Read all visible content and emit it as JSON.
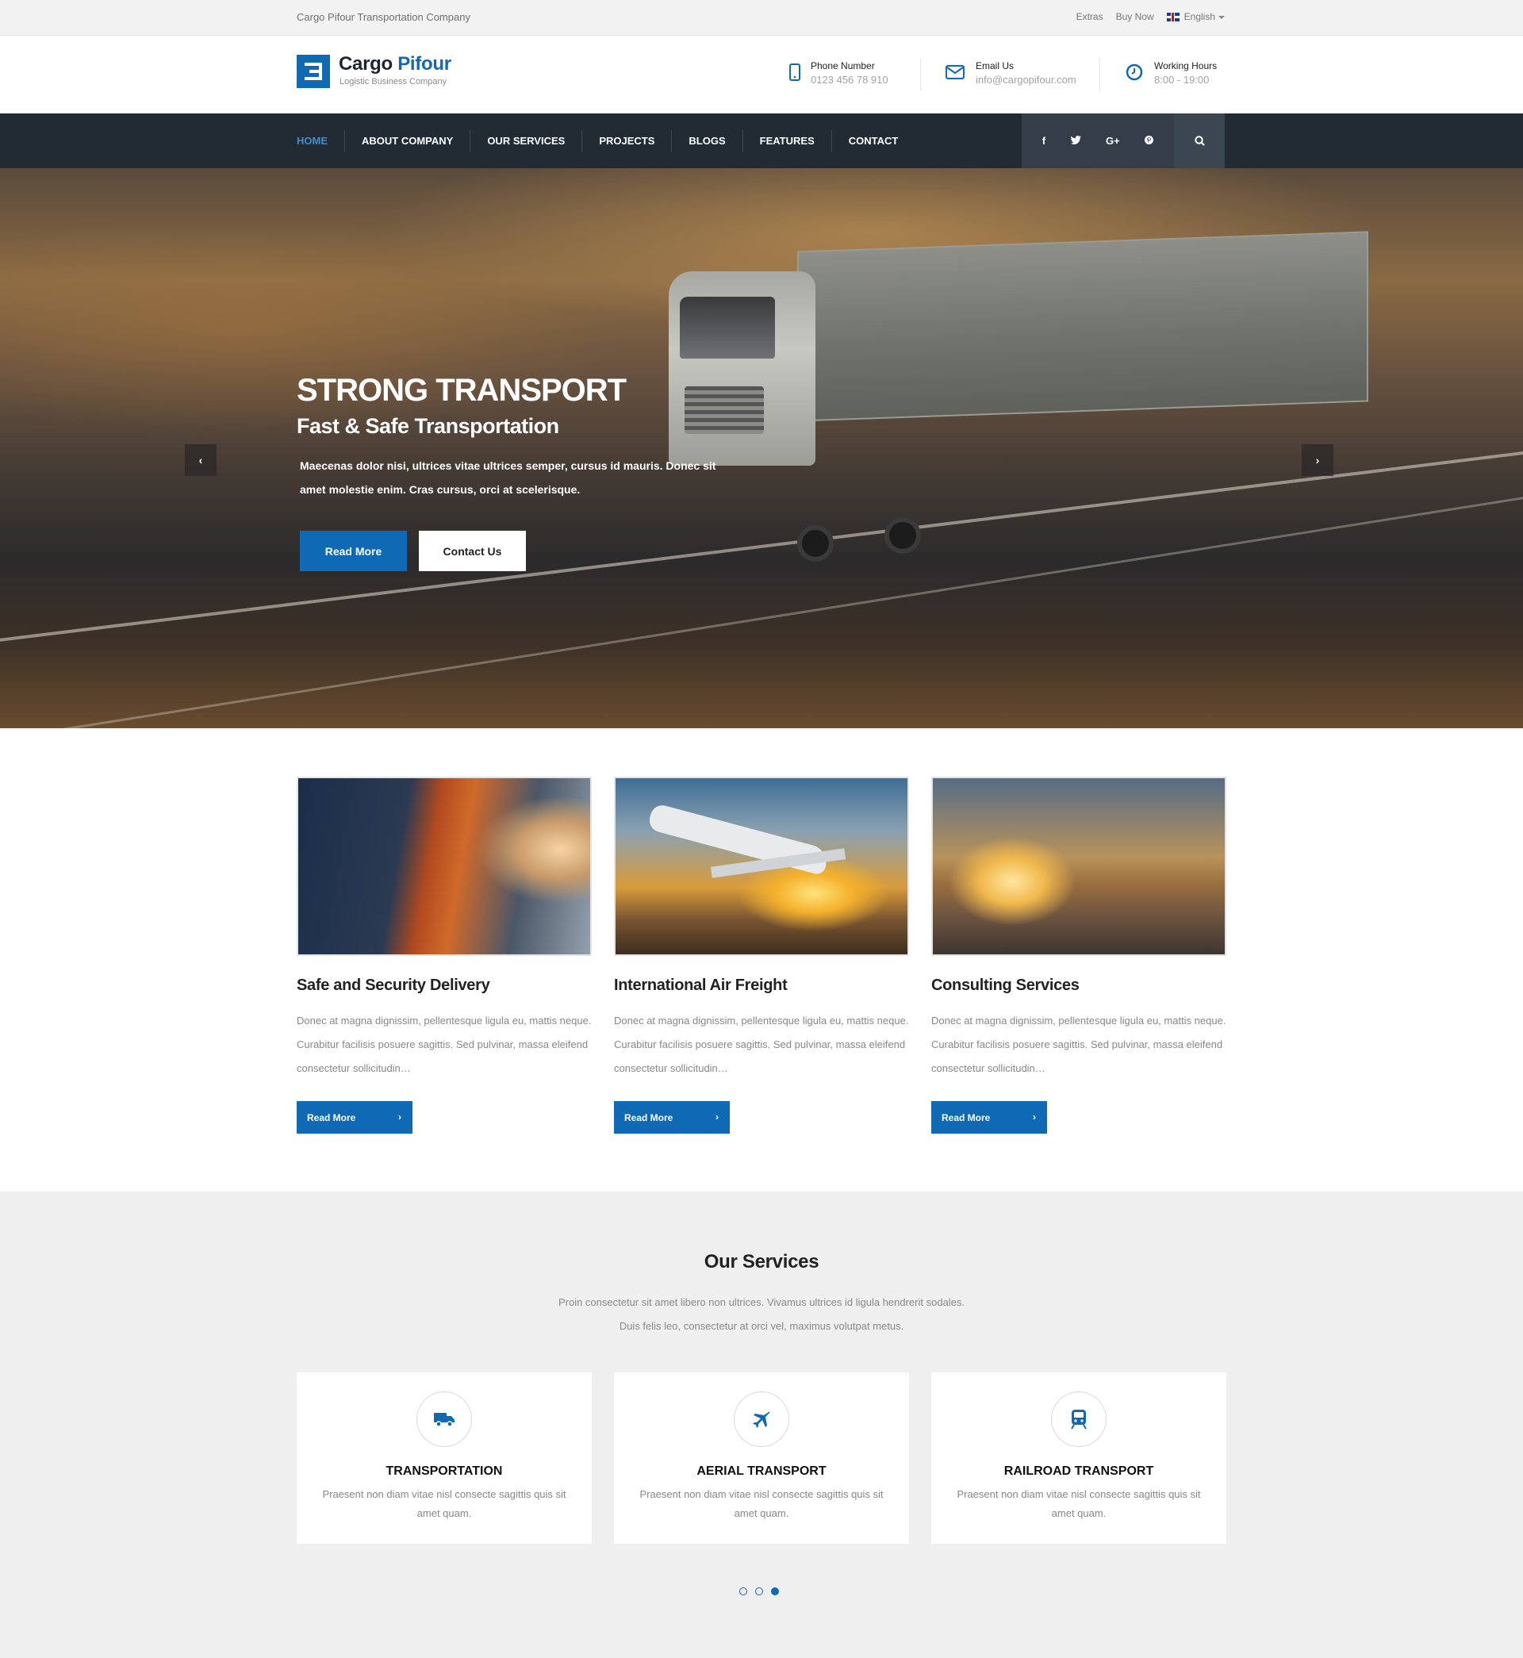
{
  "topbar": {
    "tagline": "Cargo Pifour Transportation Company",
    "links": [
      "Extras",
      "Buy Now"
    ],
    "language": "English"
  },
  "header": {
    "brand_main": "Cargo",
    "brand_accent": "Pifour",
    "brand_sub": "Logistic Business Company",
    "info": [
      {
        "label": "Phone Number",
        "value": "0123 456 78 910",
        "icon": "phone-icon"
      },
      {
        "label": "Email Us",
        "value": "info@cargopifour.com",
        "icon": "envelope-icon"
      },
      {
        "label": "Working Hours",
        "value": "8:00 - 19:00",
        "icon": "clock-icon"
      }
    ]
  },
  "nav": {
    "items": [
      "HOME",
      "ABOUT COMPANY",
      "OUR SERVICES",
      "PROJECTS",
      "BLOGS",
      "FEATURES",
      "CONTACT"
    ],
    "active": "HOME",
    "social": [
      "f",
      "t",
      "G+",
      "p"
    ]
  },
  "hero": {
    "title": "STRONG TRANSPORT",
    "subtitle": "Fast & Safe Transportation",
    "text": "Maecenas dolor nisi, ultrices vitae ultrices semper, cursus id mauris. Donec sit amet molestie enim. Cras cursus, orci at scelerisque.",
    "btn_primary": "Read More",
    "btn_secondary": "Contact Us",
    "prev": "‹",
    "next": "›"
  },
  "features": [
    {
      "title": "Safe and Security Delivery",
      "text": "Donec at magna dignissim, pellentesque ligula eu, mattis neque. Curabitur facilisis posuere sagittis. Sed pulvinar, massa eleifend consectetur sollicitudin…",
      "button": "Read More"
    },
    {
      "title": "International Air Freight",
      "text": "Donec at magna dignissim, pellentesque ligula eu, mattis neque. Curabitur facilisis posuere sagittis. Sed pulvinar, massa eleifend consectetur sollicitudin…",
      "button": "Read More"
    },
    {
      "title": "Consulting Services",
      "text": "Donec at magna dignissim, pellentesque ligula eu, mattis neque. Curabitur facilisis posuere sagittis. Sed pulvinar, massa eleifend consectetur sollicitudin…",
      "button": "Read More"
    }
  ],
  "services": {
    "title": "Our Services",
    "intro_line1": "Proin consectetur sit amet libero non ultrices. Vivamus ultrices id ligula hendrerit sodales.",
    "intro_line2": "Duis felis leo, consectetur at orci vel, maximus volutpat metus.",
    "cards": [
      {
        "title": "TRANSPORTATION",
        "text": "Praesent non diam vitae nisl consecte sagittis quis sit amet quam.",
        "icon": "truck-icon"
      },
      {
        "title": "AERIAL TRANSPORT",
        "text": "Praesent non diam vitae nisl consecte sagittis quis sit amet quam.",
        "icon": "plane-icon"
      },
      {
        "title": "RAILROAD TRANSPORT",
        "text": "Praesent non diam vitae nisl consecte sagittis quis sit amet quam.",
        "icon": "train-icon"
      }
    ],
    "pagination_total": 3,
    "pagination_active": 3
  },
  "colors": {
    "accent": "#0f69b4",
    "nav_bg": "#222b34",
    "text_muted": "#888888"
  }
}
